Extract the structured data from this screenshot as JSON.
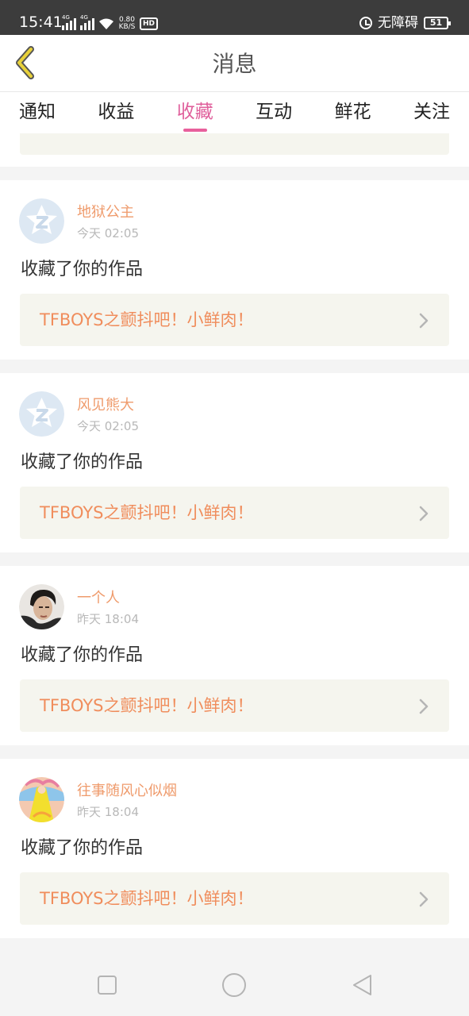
{
  "status_bar": {
    "time": "15:41",
    "network_1": "4G",
    "network_2": "4G",
    "net_speed_value": "0.80",
    "net_speed_unit": "KB/S",
    "hd_label": "HD",
    "mode_label": "无障碍",
    "battery": "51"
  },
  "header": {
    "title": "消息",
    "back_icon": "chevron-left-icon"
  },
  "tabs": [
    {
      "label": "通知",
      "active": false
    },
    {
      "label": "收益",
      "active": false
    },
    {
      "label": "收藏",
      "active": true
    },
    {
      "label": "互动",
      "active": false
    },
    {
      "label": "鲜花",
      "active": false
    },
    {
      "label": "关注",
      "active": false
    }
  ],
  "feed": {
    "items": [
      {
        "user": "地狱公主",
        "time": "今天 02:05",
        "action": "收藏了你的作品",
        "work": "TFBOYS之颤抖吧！小鲜肉！",
        "avatar": "default-qq-avatar"
      },
      {
        "user": "风见熊大",
        "time": "今天 02:05",
        "action": "收藏了你的作品",
        "work": "TFBOYS之颤抖吧！小鲜肉！",
        "avatar": "default-qq-avatar"
      },
      {
        "user": "一个人",
        "time": "昨天 18:04",
        "action": "收藏了你的作品",
        "work": "TFBOYS之颤抖吧！小鲜肉！",
        "avatar": "photo-avatar"
      },
      {
        "user": "往事随风心似烟",
        "time": "昨天 18:04",
        "action": "收藏了你的作品",
        "work": "TFBOYS之颤抖吧！小鲜肉！",
        "avatar": "illustration-avatar"
      }
    ]
  },
  "nav_bar": {
    "recents_icon": "square-icon",
    "home_icon": "circle-icon",
    "back_icon": "triangle-back-icon"
  },
  "colors": {
    "accent": "#e0609c",
    "username": "#ef9b6c",
    "work_title": "#f08d5c",
    "work_bg": "#f5f5ee",
    "back_arrow": "#e8d13a"
  }
}
